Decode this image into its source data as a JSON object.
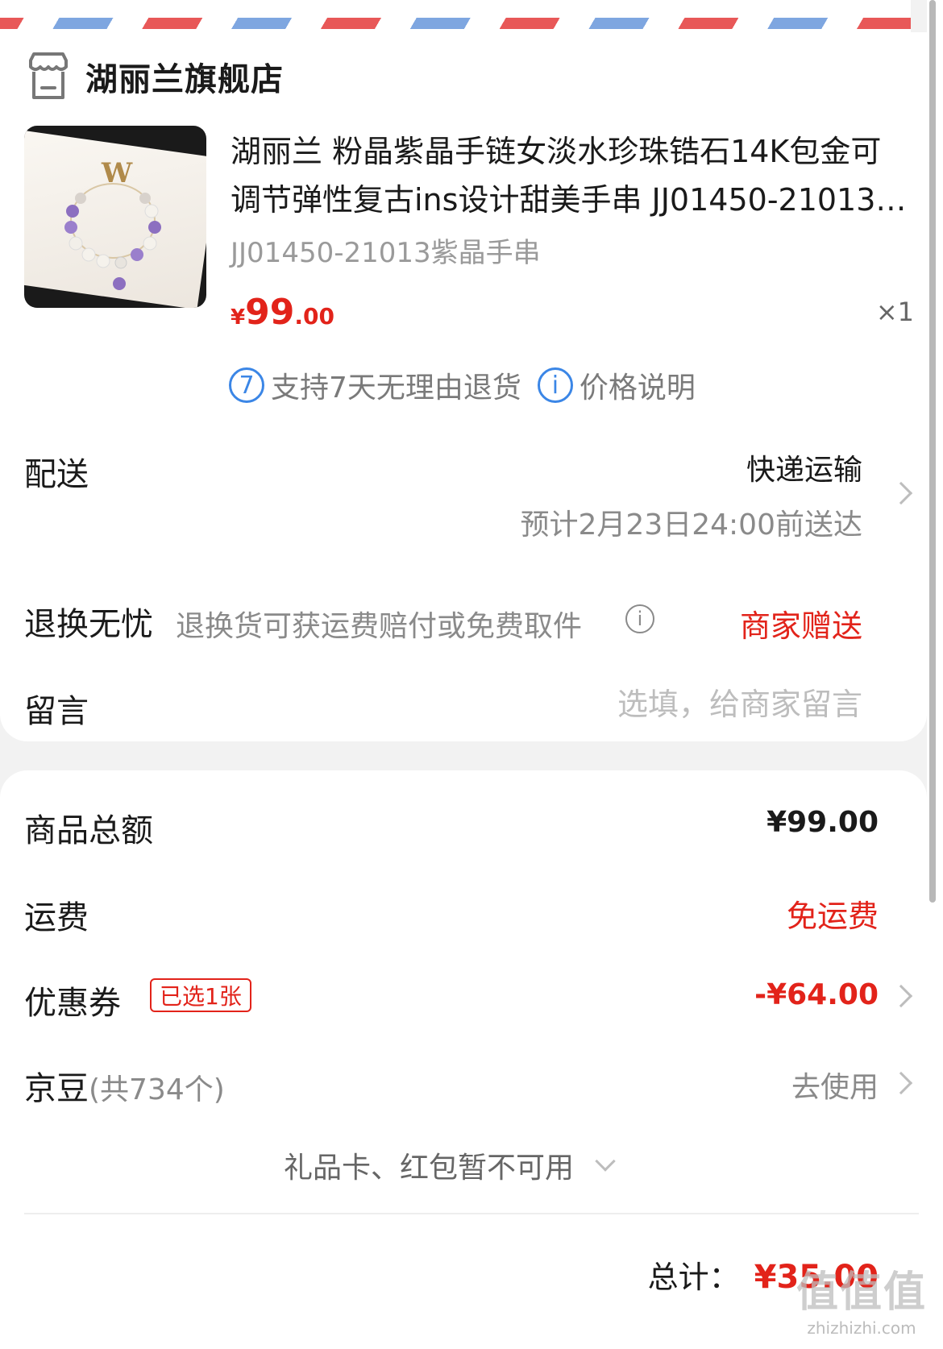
{
  "store": {
    "name": "湖丽兰旗舰店",
    "icon": "store-icon"
  },
  "product": {
    "title": "湖丽兰 粉晶紫晶手链女淡水珍珠锆石14K包金可调节弹性复古ins设计甜美手串 JJ01450-21013紫晶手串",
    "sku": "JJ01450-21013紫晶手串",
    "price_currency": "¥",
    "price_int": "99",
    "price_dec": ".00",
    "quantity": "×1"
  },
  "service_tags": [
    {
      "icon_text": "7",
      "icon": "seven-day-icon",
      "label": "支持7天无理由退货"
    },
    {
      "icon_text": "i",
      "icon": "info-icon",
      "label": "价格说明"
    }
  ],
  "delivery": {
    "label": "配送",
    "method": "快递运输",
    "eta": "预计2月23日24:00前送达"
  },
  "returns": {
    "label": "退换无忧",
    "desc": "退换货可获运费赔付或免费取件",
    "info_icon_text": "i",
    "value": "商家赠送"
  },
  "message": {
    "label": "留言",
    "placeholder": "选填，给商家留言"
  },
  "summary": {
    "goods_label": "商品总额",
    "goods_value": "¥99.00",
    "shipping_label": "运费",
    "shipping_value": "免运费",
    "coupon_label": "优惠券",
    "coupon_badge": "已选1张",
    "coupon_value": "-¥64.00",
    "jdbean_label": "京豆",
    "jdbean_count": "(共734个)",
    "jdbean_action": "去使用",
    "giftcard_text": "礼品卡、红包暂不可用",
    "total_label": "总计：",
    "total_value": "¥35.00"
  },
  "watermark": {
    "logo": "值值值",
    "url": "zhizhizhi.com"
  },
  "colors": {
    "accent_red": "#e2231a",
    "link_blue": "#3b86e6",
    "airmail_red": "#e85858",
    "airmail_blue": "#7ea6e0"
  }
}
